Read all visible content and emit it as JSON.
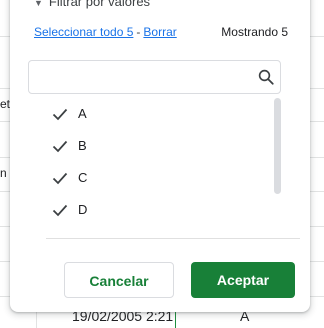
{
  "sheet_fragments": {
    "left_text_1": "et",
    "left_text_2": "n",
    "bottom_date": "19/02/2005 2:21",
    "bottom_value": "A"
  },
  "filter": {
    "title": "Filtrar por valores",
    "select_all_link": "Seleccionar todo 5",
    "separator": "-",
    "clear_link": "Borrar",
    "showing_text": "Mostrando 5",
    "search": {
      "value": "",
      "placeholder": ""
    },
    "values": [
      {
        "label": "A",
        "checked": true
      },
      {
        "label": "B",
        "checked": true
      },
      {
        "label": "C",
        "checked": true
      },
      {
        "label": "D",
        "checked": true
      }
    ],
    "cancel_label": "Cancelar",
    "accept_label": "Aceptar"
  },
  "colors": {
    "link": "#1a73e8",
    "primary_green": "#188038",
    "border": "#dadce0"
  }
}
